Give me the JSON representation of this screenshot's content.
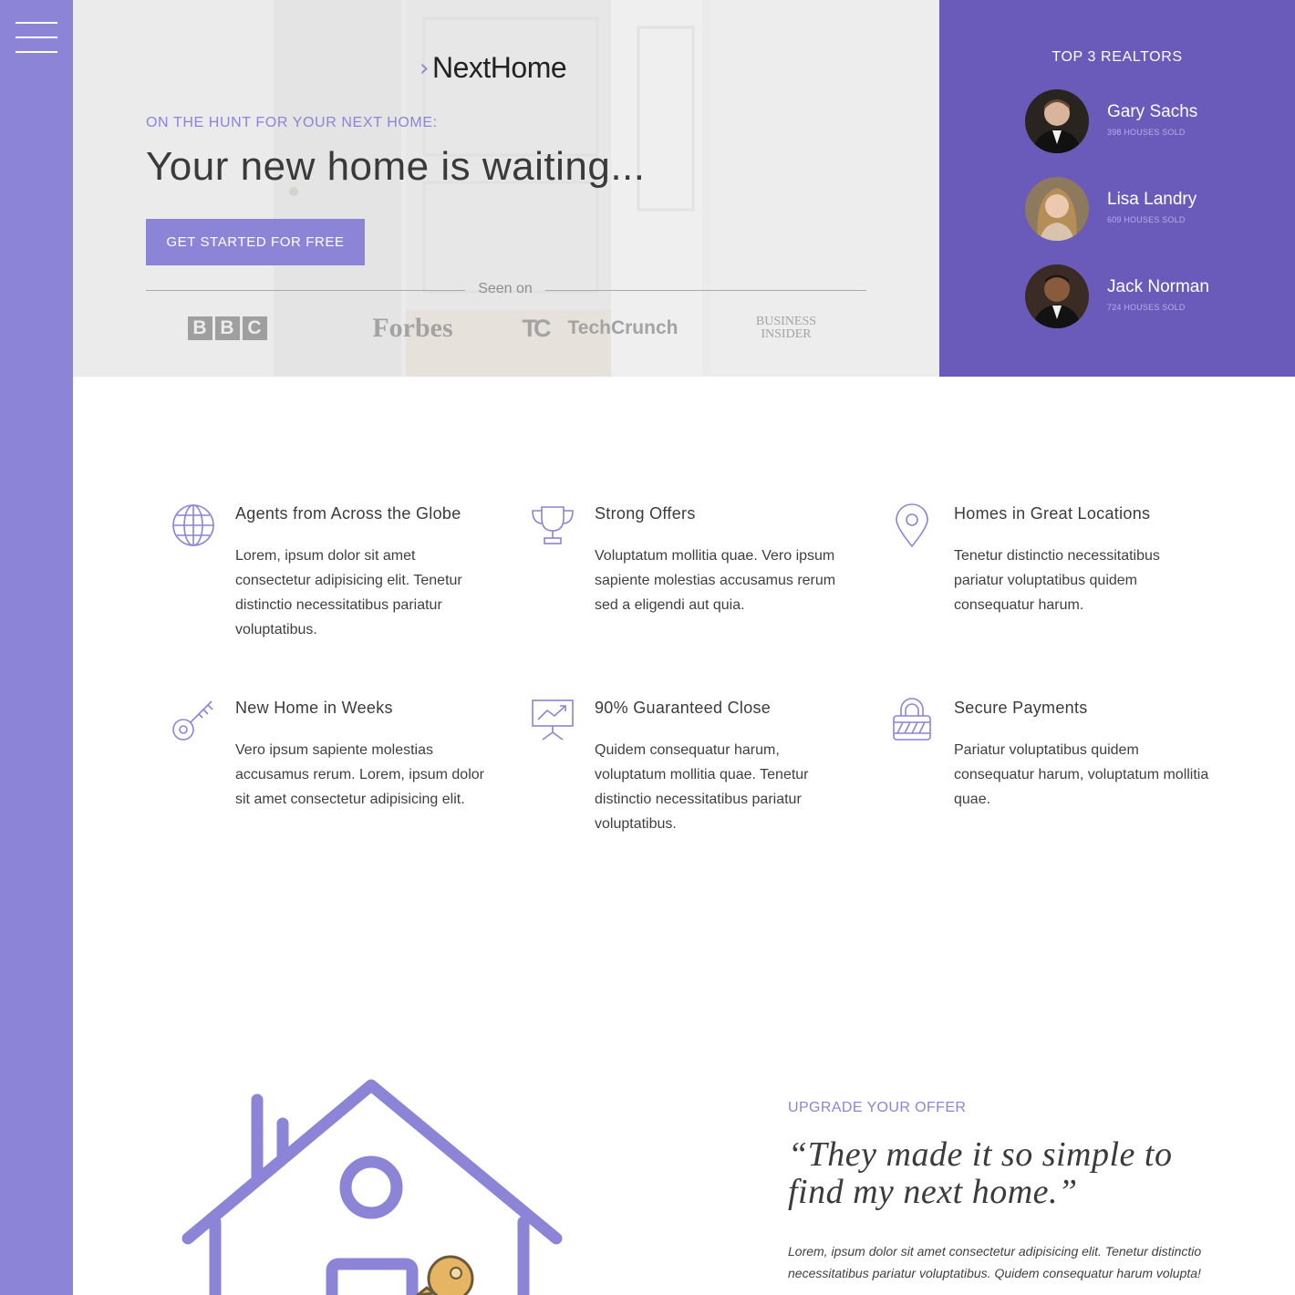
{
  "colors": {
    "accent": "#8b84d7",
    "panel": "#6a5bbb",
    "text": "#3b3b3b",
    "key": "#e6b564"
  },
  "hero": {
    "logo_text": "NextHome",
    "kicker": "ON THE HUNT FOR YOUR NEXT HOME:",
    "headline": "Your new home is waiting...",
    "cta_label": "GET STARTED FOR FREE",
    "seen_on": "Seen on",
    "press": {
      "bbc": [
        "B",
        "B",
        "C"
      ],
      "forbes": "Forbes",
      "techcrunch_mark": "TC",
      "techcrunch": "TechCrunch",
      "business": "BUSINESS",
      "insider": "INSIDER"
    }
  },
  "realtors": {
    "title": "TOP 3 REALTORS",
    "items": [
      {
        "name": "Gary Sachs",
        "sold": "398 HOUSES SOLD",
        "icon": "avatar-icon"
      },
      {
        "name": "Lisa Landry",
        "sold": "609 HOUSES SOLD",
        "icon": "avatar-icon"
      },
      {
        "name": "Jack Norman",
        "sold": "724 HOUSES SOLD",
        "icon": "avatar-icon"
      }
    ]
  },
  "features": [
    {
      "icon": "globe-icon",
      "title": "Agents from Across the Globe",
      "text": "Lorem, ipsum dolor sit amet consectetur adipisicing elit. Tenetur distinctio necessitatibus pariatur voluptatibus."
    },
    {
      "icon": "trophy-icon",
      "title": "Strong Offers",
      "text": "Voluptatum mollitia quae. Vero ipsum sapiente molestias accusamus rerum sed a eligendi aut quia."
    },
    {
      "icon": "location-pin-icon",
      "title": "Homes in Great Locations",
      "text": "Tenetur distinctio necessitatibus pariatur voluptatibus quidem consequatur harum."
    },
    {
      "icon": "key-icon",
      "title": "New Home in Weeks",
      "text": "Vero ipsum sapiente molestias accusamus rerum. Lorem, ipsum dolor sit amet consectetur adipisicing elit."
    },
    {
      "icon": "presentation-chart-icon",
      "title": "90% Guaranteed Close",
      "text": "Quidem consequatur harum, voluptatum mollitia quae. Tenetur distinctio necessitatibus pariatur voluptatibus."
    },
    {
      "icon": "padlock-icon",
      "title": "Secure Payments",
      "text": "Pariatur voluptatibus quidem consequatur harum, voluptatum mollitia quae."
    }
  ],
  "testimonial": {
    "kicker": "UPGRADE YOUR OFFER",
    "quote": "“They made it so simple to find my next home.”",
    "body": "Lorem, ipsum dolor sit amet consectetur adipisicing elit. Tenetur distinctio necessitatibus pariatur voluptatibus. Quidem consequatur harum volupta!"
  }
}
